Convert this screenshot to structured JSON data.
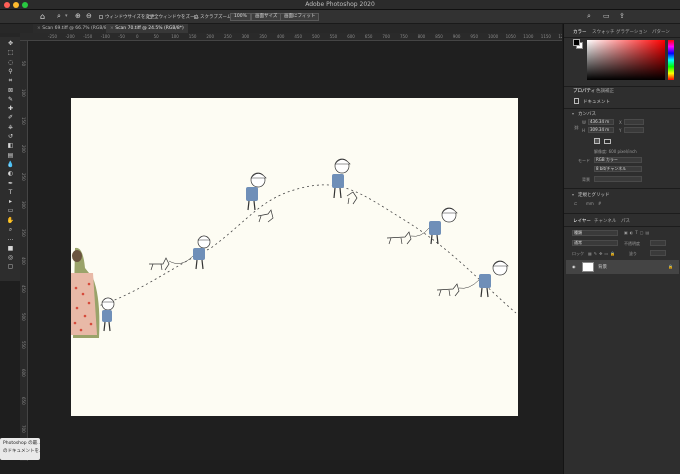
{
  "window": {
    "title": "Adobe Photoshop 2020",
    "traffic_lights": [
      "#ff5f57",
      "#febc2e",
      "#28c840"
    ]
  },
  "options_bar": {
    "resize_windows": "ウィンドウサイズを変更",
    "zoom_all_windows": "全ウィンドウをズーム",
    "scrubby_zoom": "スクラブズーム",
    "zoom_level": "100%",
    "fit_screen": "画面サイズ",
    "fill_screen": "画面にフィット"
  },
  "tabs": [
    {
      "label": "Scan 69.tiff @ 66.7% (RGB/8*)",
      "active": false
    },
    {
      "label": "Scan 70.tiff @ 24.5% (RGB/8*)",
      "active": true
    }
  ],
  "rulers": {
    "top": [
      "-250",
      "-200",
      "-150",
      "-100",
      "-50",
      "0",
      "50",
      "100",
      "150",
      "200",
      "250",
      "300",
      "350",
      "400",
      "450",
      "500",
      "550",
      "600",
      "650",
      "700",
      "750",
      "800",
      "850",
      "900",
      "950",
      "1000",
      "1050",
      "1100",
      "1150",
      "1200",
      "1250"
    ],
    "left": [
      "50",
      "100",
      "150",
      "200",
      "250",
      "300",
      "350",
      "400",
      "450",
      "500",
      "550",
      "600",
      "650",
      "700"
    ]
  },
  "toolbar": {
    "tools": [
      "move-tool",
      "marquee-tool",
      "lasso-tool",
      "quick-select-tool",
      "crop-tool",
      "frame-tool",
      "eyedropper-tool",
      "healing-tool",
      "brush-tool",
      "stamp-tool",
      "history-brush-tool",
      "eraser-tool",
      "gradient-tool",
      "blur-tool",
      "dodge-tool",
      "pen-tool",
      "type-tool",
      "path-select-tool",
      "shape-tool",
      "hand-tool",
      "zoom-tool",
      "edit-toolbar",
      "color-swatches",
      "quick-mask",
      "screen-mode"
    ],
    "fg_color": "#000000",
    "bg_color": "#ffffff"
  },
  "panels": {
    "color_tabs": [
      "カラー",
      "スウォッチ",
      "グラデーション",
      "パターン"
    ],
    "props_tabs": [
      "プロパティ",
      "色調補正"
    ],
    "doc_label": "ドキュメント",
    "canvas_heading": "カンバス",
    "w_label": "W",
    "w_value": "436.34 m",
    "h_label": "H",
    "h_value": "309.34 m",
    "x_label": "X",
    "y_label": "Y",
    "resolution": "解像度: 600 pixel/inch",
    "mode_label": "モード",
    "mode_value": "RGB カラー",
    "depth_value": "8 bit/チャンネル",
    "bg_label": "背景",
    "rulers_grid": "定規とグリッド",
    "rulers_unit": "mm",
    "layer_tabs": [
      "レイヤー",
      "チャンネル",
      "パス"
    ],
    "kind_label": "種類",
    "blend_mode": "通常",
    "opacity_label": "不透明度",
    "lock_label": "ロック",
    "fill_label": "塗り",
    "layer_name": "背景"
  },
  "notification": {
    "line1": "Photoshop の最...",
    "line2": "のドキュメントを..."
  }
}
